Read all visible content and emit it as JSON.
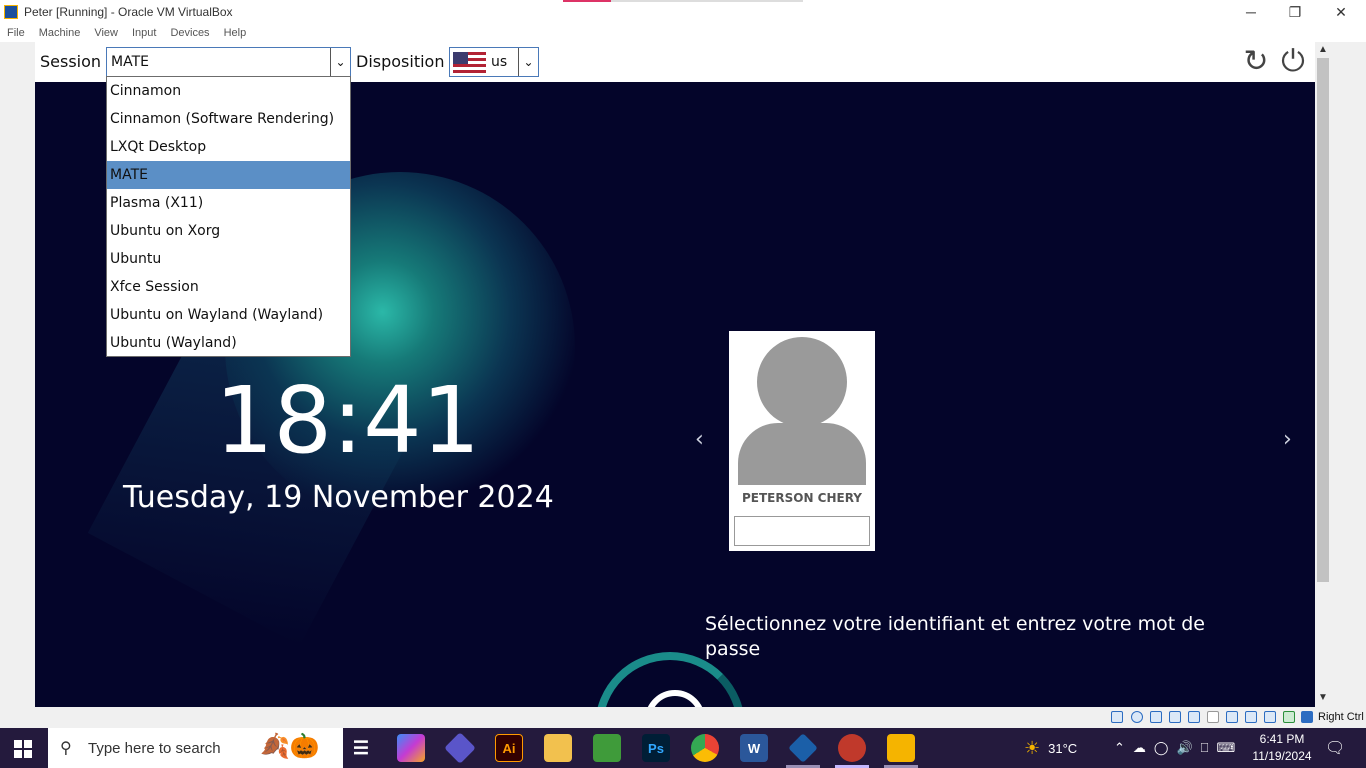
{
  "window": {
    "title": "Peter [Running] - Oracle VM VirtualBox",
    "minimize": "─",
    "restore": "❐",
    "close": "✕"
  },
  "menu": [
    "File",
    "Machine",
    "View",
    "Input",
    "Devices",
    "Help"
  ],
  "toolbar": {
    "session_label": "Session",
    "session_value": "MATE",
    "layout_label": "Disposition",
    "layout_value": "us",
    "restart_glyph": "↻",
    "power_glyph": "⏻"
  },
  "session_options": [
    "Cinnamon",
    "Cinnamon (Software Rendering)",
    "LXQt Desktop",
    "MATE",
    "Plasma (X11)",
    "Ubuntu on Xorg",
    "Ubuntu",
    "Xfce Session",
    "Ubuntu on Wayland (Wayland)",
    "Ubuntu (Wayland)"
  ],
  "session_selected_index": 3,
  "greeter": {
    "time": "18:41",
    "date": "Tuesday, 19 November 2024",
    "user_name": "PETERSON CHERY",
    "password_value": "",
    "prev": "‹",
    "next": "›",
    "hint": "Sélectionnez votre identifiant et entrez votre mot de passe"
  },
  "statusbar": {
    "host_key": "Right Ctrl"
  },
  "taskbar": {
    "search_placeholder": "Type here to search",
    "apps": [
      "task-view",
      "copilot",
      "git",
      "illustrator",
      "file-explorer",
      "vector-app",
      "photoshop",
      "chrome",
      "word",
      "virtualbox",
      "gitkraken",
      "virtualbox-vm"
    ],
    "ai_label": "Ai",
    "ps_label": "Ps",
    "word_label": "W",
    "weather": "31°C",
    "time": "6:41 PM",
    "date": "11/19/2024"
  },
  "colors": {
    "selected_option": "#5b8fc6",
    "greeter_bg": "#04052a",
    "accent_teal": "#2bb8a8",
    "taskbar_bg": "#241a3d"
  }
}
